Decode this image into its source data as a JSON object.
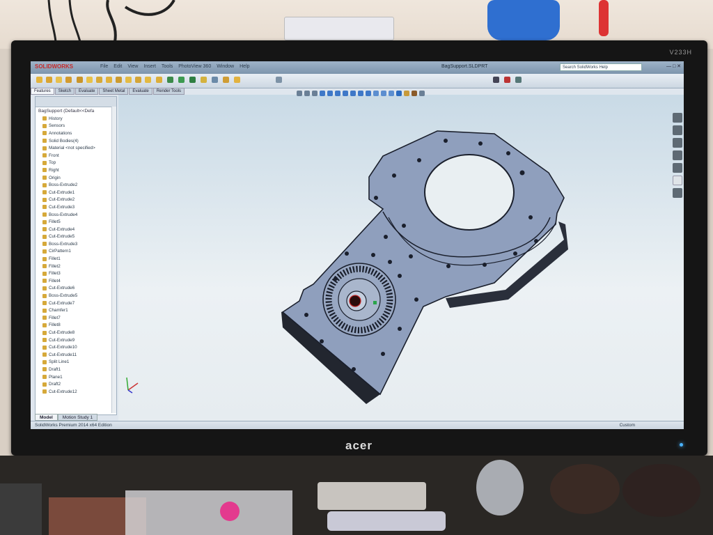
{
  "monitor": {
    "model": "V233H",
    "brand": "acer"
  },
  "app": {
    "logo": "SOLIDWORKS",
    "document_title": "BagSupport.SLDPRT",
    "menu": [
      "File",
      "Edit",
      "View",
      "Insert",
      "Tools",
      "PhotoView 360",
      "Window",
      "Help"
    ],
    "search_placeholder": "Search SolidWorks Help",
    "command_tabs": [
      "Features",
      "Sketch",
      "Evaluate",
      "Sheet Metal",
      "Evaluate",
      "Render Tools"
    ]
  },
  "feature_tree": {
    "root": "BagSupport (Default<<Defa",
    "items": [
      "History",
      "Sensors",
      "Annotations",
      "Solid Bodies(4)",
      "Material <not specified>",
      "Front",
      "Top",
      "Right",
      "Origin",
      "Boss-Extrude2",
      "Cut-Extrude1",
      "Cut-Extrude2",
      "Cut-Extrude3",
      "Boss-Extrude4",
      "Fillet5",
      "Cut-Extrude4",
      "Cut-Extrude5",
      "Boss-Extrude3",
      "CirPattern1",
      "Fillet1",
      "Fillet2",
      "Fillet3",
      "Fillet4",
      "Cut-Extrude6",
      "Boss-Extrude5",
      "Cut-Extrude7",
      "Chamfer1",
      "Fillet7",
      "Fillet8",
      "Cut-Extrude8",
      "Cut-Extrude9",
      "Cut-Extrude10",
      "Cut-Extrude11",
      "Split Line1",
      "Draft1",
      "Plane1",
      "Draft2",
      "Cut-Extrude12"
    ]
  },
  "bottom_tabs": [
    "Model",
    "Motion Study 1"
  ],
  "status": {
    "left": "SolidWorks Premium 2014 x64 Edition",
    "right": "Custom"
  },
  "colors": {
    "part_fill": "#8f9fbd",
    "part_edge": "#1a1f2c",
    "viewport_top": "#c9dae6",
    "viewport_bottom": "#ecf1f4"
  }
}
